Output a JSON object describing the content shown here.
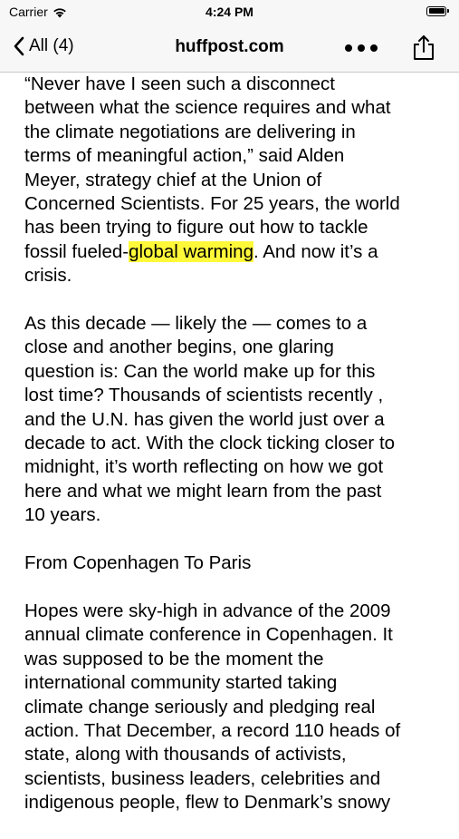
{
  "status": {
    "carrier": "Carrier",
    "time": "4:24 PM"
  },
  "nav": {
    "back_label": "All (4)",
    "title": "huffpost.com",
    "more_label": "•••"
  },
  "article": {
    "p1": [
      "“Never have I seen such a disconnect",
      "between what the science requires and what",
      "the climate negotiations are delivering in",
      "terms of meaningful action,” said Alden",
      "Meyer, strategy chief at the Union of",
      "Concerned Scientists. For 25 years, the world",
      "has been trying to figure out how to tackle"
    ],
    "p1_tail_before": "fossil fueled-",
    "p1_highlight": "global warming",
    "p1_tail_after": ". And now it’s a",
    "p1_last": "crisis.",
    "p2": [
      "As this decade — likely the — comes to a",
      "close and another begins, one glaring",
      "question is: Can the world make up for this",
      "lost time? Thousands of scientists recently ,",
      "and the U.N. has given the world just over a",
      "decade to act. With the clock ticking closer to",
      "midnight, it’s worth reflecting on how we got",
      "here and what we might learn from the past",
      "10 years."
    ],
    "heading": "From Copenhagen To Paris",
    "p3": [
      "Hopes were sky-high in advance of the 2009",
      "annual climate conference in Copenhagen. It",
      "was supposed to be the moment the",
      "international community started taking",
      "climate change seriously and pledging real",
      "action. That December, a record 110 heads of",
      "state, along with thousands of activists,",
      "scientists, business leaders, celebrities and",
      "indigenous people, flew to Denmark’s snowy"
    ]
  },
  "icons": {
    "wifi": "wifi-icon",
    "battery": "battery-icon",
    "back": "chevron-left-icon",
    "more": "ellipsis-icon",
    "share": "share-icon"
  },
  "colors": {
    "highlight": "#fff93a",
    "bar_background": "#f7f7f7"
  }
}
